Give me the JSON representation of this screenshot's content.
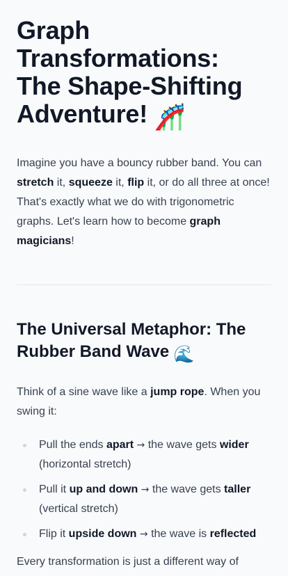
{
  "title": {
    "line1": "Graph",
    "line2": "Transformations:",
    "line3": "The Shape-Shifting",
    "line4": "Adventure!",
    "emoji": "🎢",
    "emoji_name": "roller-coaster-icon"
  },
  "intro": {
    "t1": "Imagine you have a bouncy rubber band. You can ",
    "b1": "stretch",
    "t2": " it, ",
    "b2": "squeeze",
    "t3": " it, ",
    "b3": "flip",
    "t4": " it, or do all three at once! That's exactly what we do with trigonometric graphs. Let's learn how to become ",
    "b4": "graph magicians",
    "t5": "!"
  },
  "section": {
    "heading": "The Universal Metaphor: The Rubber Band Wave",
    "emoji": "🌊",
    "emoji_name": "wave-icon",
    "lead_t1": "Think of a sine wave like a ",
    "lead_b1": "jump rope",
    "lead_t2": ". When you swing it:",
    "items": [
      {
        "t1": "Pull the ends ",
        "b1": "apart",
        "arrow": "→",
        "t2": " the wave gets ",
        "b2": "wider",
        "t3": " (horizontal stretch)"
      },
      {
        "t1": "Pull it ",
        "b1": "up and down",
        "arrow": "→",
        "t2": " the wave gets ",
        "b2": "taller",
        "t3": " (vertical stretch)"
      },
      {
        "t1": "Flip it ",
        "b1": "upside down",
        "arrow": "→",
        "t2": " the wave is ",
        "b2": "reflected",
        "t3": ""
      }
    ],
    "outro": "Every transformation is just a different way of"
  }
}
